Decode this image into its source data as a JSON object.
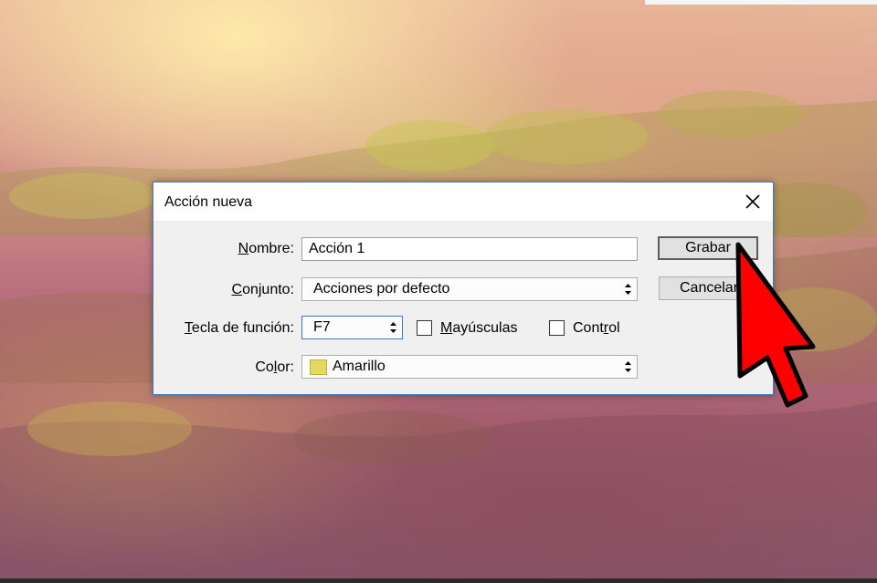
{
  "dialog": {
    "title": "Acción nueva",
    "close_icon": "close-icon",
    "name_label_underlined": "N",
    "name_label_rest": "ombre:",
    "name_value": "Acción 1",
    "set_label_underlined": "C",
    "set_label_rest": "onjunto:",
    "set_value": "Acciones por defecto",
    "fkey_label_underlined": "T",
    "fkey_label_rest": "ecla de función:",
    "fkey_value": "F7",
    "shift_label_pre": "",
    "shift_label_underlined": "M",
    "shift_label_rest": "ayúsculas",
    "control_label_pre": "Cont",
    "control_label_underlined": "r",
    "control_label_rest": "ol",
    "color_label_pre": "Co",
    "color_label_underlined": "l",
    "color_label_rest": "or:",
    "color_value": "Amarillo",
    "color_swatch": "#e3d95a",
    "record_button": "Grabar",
    "cancel_button": "Cancelar"
  },
  "pointer": {
    "icon": "red-arrow-cursor-icon",
    "color": "#ff0000"
  }
}
